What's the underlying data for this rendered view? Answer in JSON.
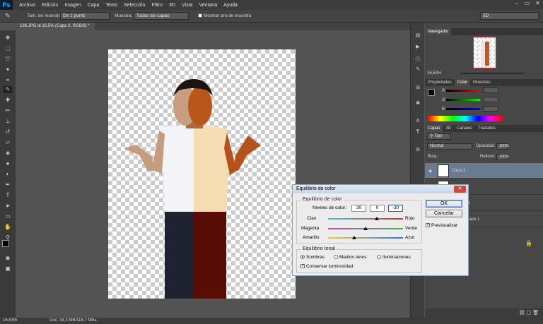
{
  "app": {
    "logo": "Ps",
    "window_controls": [
      "–",
      "▭",
      "✕"
    ]
  },
  "menu": [
    "Archivo",
    "Edición",
    "Imagen",
    "Capa",
    "Texto",
    "Selección",
    "Filtro",
    "3D",
    "Vista",
    "Ventana",
    "Ayuda"
  ],
  "options": {
    "sample_size_label": "Tam. de muestra:",
    "sample_size_value": "De 1 punto",
    "sample_label": "Muestra:",
    "sample_value": "Todas las capas",
    "show_ring_label": "Mostrar aro de muestra",
    "workspace": "3D"
  },
  "document_tab": "196.JPG al 16,5% (Capa 3, RGB/8) *",
  "status": {
    "zoom": "16,53%",
    "doc": "Doc: 34,3 MB/118,7 MB"
  },
  "navigator": {
    "title": "Navegador",
    "zoom": "16,53%"
  },
  "color_panel": {
    "tabs": [
      "Propiedades",
      "Color",
      "Muestras"
    ],
    "active": "Color",
    "channels": [
      "R",
      "G",
      "B"
    ]
  },
  "layers_panel": {
    "tabs": [
      "Capas",
      "3D",
      "Canales",
      "Trazados"
    ],
    "filter": "Tipo",
    "blend_mode": "Normal",
    "opacity_label": "Opacidad:",
    "opacity_value": "100%",
    "lock_label": "Bloq.:",
    "fill_label": "Relleno:",
    "fill_value": "100%",
    "layers": [
      {
        "name": "Capa 3",
        "selected": true
      },
      {
        "name": "",
        "selected": false
      },
      {
        "name": "pia",
        "selected": false
      },
      {
        "name": "Capa 1",
        "selected": false
      }
    ]
  },
  "dialog": {
    "title": "Equilibrio de color",
    "close": "✕",
    "balance_group": "Equilibrio de color",
    "levels_label": "Niveles de color:",
    "levels": [
      "30",
      "0",
      "-30"
    ],
    "sliders": [
      {
        "left": "Cian",
        "right": "Rojo",
        "value": 30,
        "color": "#d8303a"
      },
      {
        "left": "Magenta",
        "right": "Verde",
        "value": 0,
        "color": "#3bbf4e"
      },
      {
        "left": "Amarillo",
        "right": "Azul",
        "value": -30,
        "color": "#3b6de0"
      }
    ],
    "tone_group": "Equilibrio tonal",
    "tones": [
      {
        "label": "Sombras",
        "selected": true
      },
      {
        "label": "Medios tonos",
        "selected": false
      },
      {
        "label": "Iluminaciones",
        "selected": false
      }
    ],
    "preserve_label": "Conservar luminosidad",
    "preserve_checked": true,
    "ok": "OK",
    "cancel": "Cancelar",
    "preview_label": "Previsualizar",
    "preview_checked": true
  },
  "colors": {
    "accent": "#1f5fb5",
    "dialog_bg": "#ececec",
    "panel_bg": "#474747"
  }
}
